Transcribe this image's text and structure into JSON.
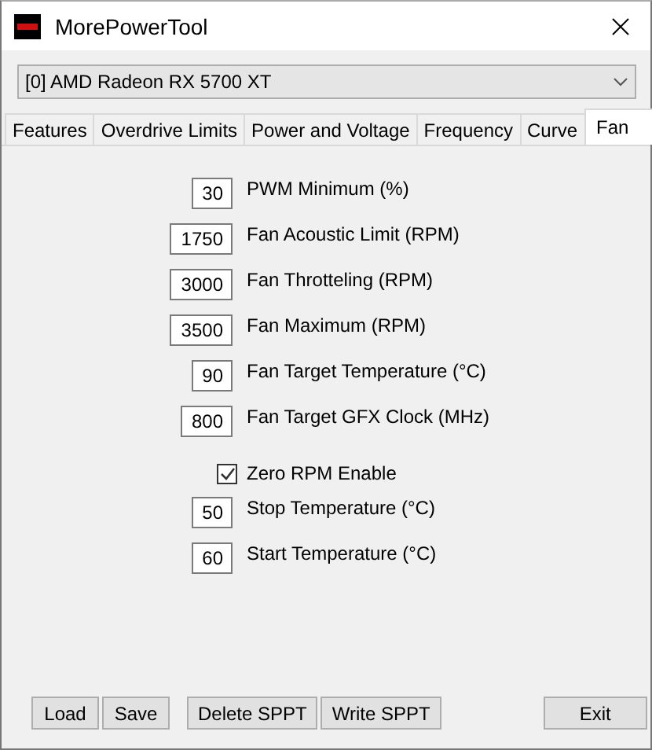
{
  "window": {
    "title": "MorePowerTool"
  },
  "device_select": {
    "value": "[0] AMD Radeon RX 5700 XT"
  },
  "tabs": [
    {
      "label": "Features",
      "selected": false
    },
    {
      "label": "Overdrive Limits",
      "selected": false
    },
    {
      "label": "Power and Voltage",
      "selected": false
    },
    {
      "label": "Frequency",
      "selected": false
    },
    {
      "label": "Curve",
      "selected": false
    },
    {
      "label": "Fan",
      "selected": true
    }
  ],
  "settings": [
    {
      "kind": "number",
      "value": "30",
      "label": "PWM Minimum (%)"
    },
    {
      "kind": "number",
      "value": "1750",
      "label": "Fan Acoustic Limit (RPM)"
    },
    {
      "kind": "number",
      "value": "3000",
      "label": "Fan Throtteling (RPM)"
    },
    {
      "kind": "number",
      "value": "3500",
      "label": "Fan Maximum (RPM)"
    },
    {
      "kind": "number",
      "value": "90",
      "label": "Fan Target Temperature (°C)"
    },
    {
      "kind": "number",
      "value": "800",
      "label": "Fan Target GFX Clock (MHz)"
    },
    {
      "kind": "checkbox",
      "label": "Zero RPM Enable",
      "checked": true
    },
    {
      "kind": "number",
      "value": "50",
      "label": "Stop Temperature (°C)"
    },
    {
      "kind": "number",
      "value": "60",
      "label": "Start Temperature (°C)"
    }
  ],
  "buttons": [
    {
      "label": "Load",
      "kind": "file"
    },
    {
      "label": "Save",
      "kind": "file"
    },
    {
      "label": "Delete SPPT",
      "kind": "sppt"
    },
    {
      "label": "Write SPPT",
      "kind": "sppt"
    },
    {
      "label": "Exit",
      "kind": "exit"
    }
  ]
}
